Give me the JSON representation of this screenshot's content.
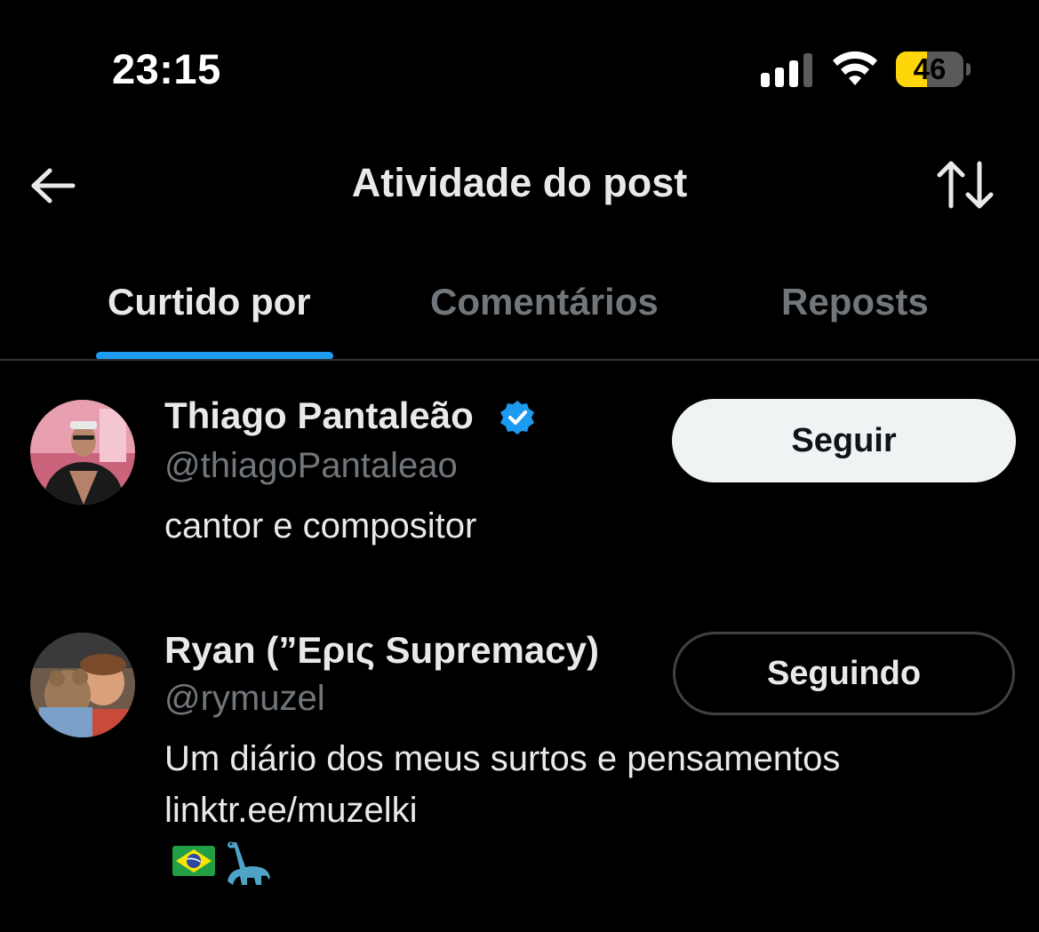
{
  "status_bar": {
    "time": "23:15",
    "battery_percent": "46",
    "battery_level": 0.46,
    "accent_battery": "#ffd60a"
  },
  "header": {
    "title": "Atividade do post",
    "back_icon": "arrow-left-icon",
    "sort_icon": "sort-arrows-icon"
  },
  "tabs": [
    {
      "label": "Curtido por",
      "active": true
    },
    {
      "label": "Comentários",
      "active": false
    },
    {
      "label": "Reposts",
      "active": false
    }
  ],
  "colors": {
    "accent": "#1d9bf0",
    "muted_text": "#71767b",
    "primary_text": "#e7e9ea"
  },
  "users": [
    {
      "name": "Thiago Pantaleão",
      "verified": true,
      "handle": "@thiagoPantaleao",
      "bio": [
        "cantor e compositor"
      ],
      "follow_label": "Seguir",
      "following": false
    },
    {
      "name": "Ryan (”Ερις Supremacy)",
      "verified": false,
      "handle": "@rymuzel",
      "bio": [
        "Um diário dos meus surtos e pensamentos",
        "linktr.ee/muzelki"
      ],
      "bio_emojis": [
        "brazil-flag-icon",
        "sauropod-icon"
      ],
      "follow_label": "Seguindo",
      "following": true
    }
  ]
}
